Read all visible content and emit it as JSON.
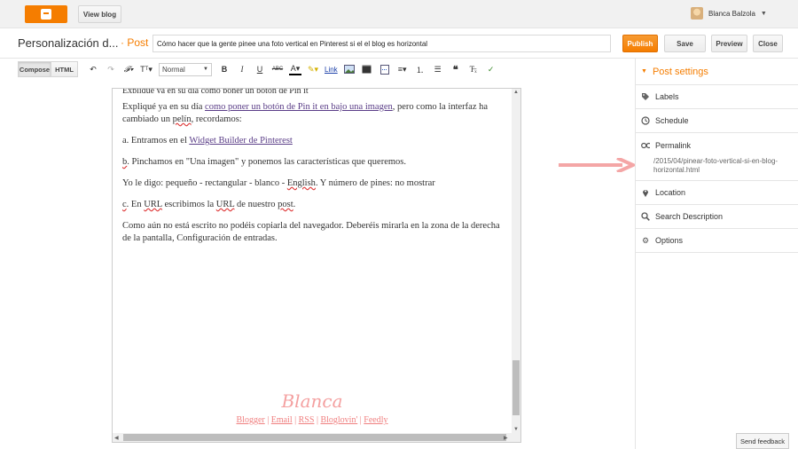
{
  "topbar": {
    "view_blog_label": "View blog",
    "user_name": "Blanca Balzola"
  },
  "header": {
    "blog_name": "Personalización d...",
    "post_word": "· Post",
    "post_title": "Cómo hacer que la gente pinee una foto vertical en Pinterest si el el blog es horizontal",
    "publish_label": "Publish",
    "save_label": "Save",
    "preview_label": "Preview",
    "close_label": "Close"
  },
  "toolbar": {
    "compose_label": "Compose",
    "html_label": "HTML",
    "font_size_value": "Normal",
    "link_label": "Link"
  },
  "editor": {
    "p1_a": "Expliqué ya en su día ",
    "p1_link": "como poner un botón de Pin it en bajo una imagen",
    "p1_b": ", pero como la interfaz ha cambiado un ",
    "p1_pelin": "pelín",
    "p1_c": ", recordamos:",
    "p2_a": "a. Entramos en el ",
    "p2_link": "Widget Builder de Pinterest",
    "p3_a": "b",
    "p3_b": ". Pinchamos en \"Una imagen\" y ponemos las características que queremos.",
    "p4_a": "Yo le digo: pequeño - rectangular - blanco - ",
    "p4_english": "English",
    "p4_b": ". Y número de pines: no mostrar",
    "p5_a": "c",
    "p5_b": ". En ",
    "p5_url1": "URL",
    "p5_c": " escribimos la ",
    "p5_url2": "URL",
    "p5_d": " de nuestro ",
    "p5_post": "post",
    "p5_e": ".",
    "p6": "Como aún no está escrito no podéis copiarla del navegador. Deberéis mirarla en la zona de la derecha de la pantalla, Configuración de entradas.",
    "signature": "Blanca",
    "footer_links": [
      "Blogger",
      "Email",
      "RSS",
      "Bloglovin'",
      "Feedly"
    ]
  },
  "post_settings": {
    "heading": "Post settings",
    "labels": "Labels",
    "schedule": "Schedule",
    "permalink": "Permalink",
    "permalink_url": "/2015/04/pinear-foto-vertical-si-en-blog-horizontal.html",
    "location": "Location",
    "search_description": "Search Description",
    "options": "Options"
  },
  "feedback_label": "Send feedback",
  "colors": {
    "accent": "#f57d00",
    "arrow": "#f4a6a6",
    "signature": "#f4a0a0"
  }
}
